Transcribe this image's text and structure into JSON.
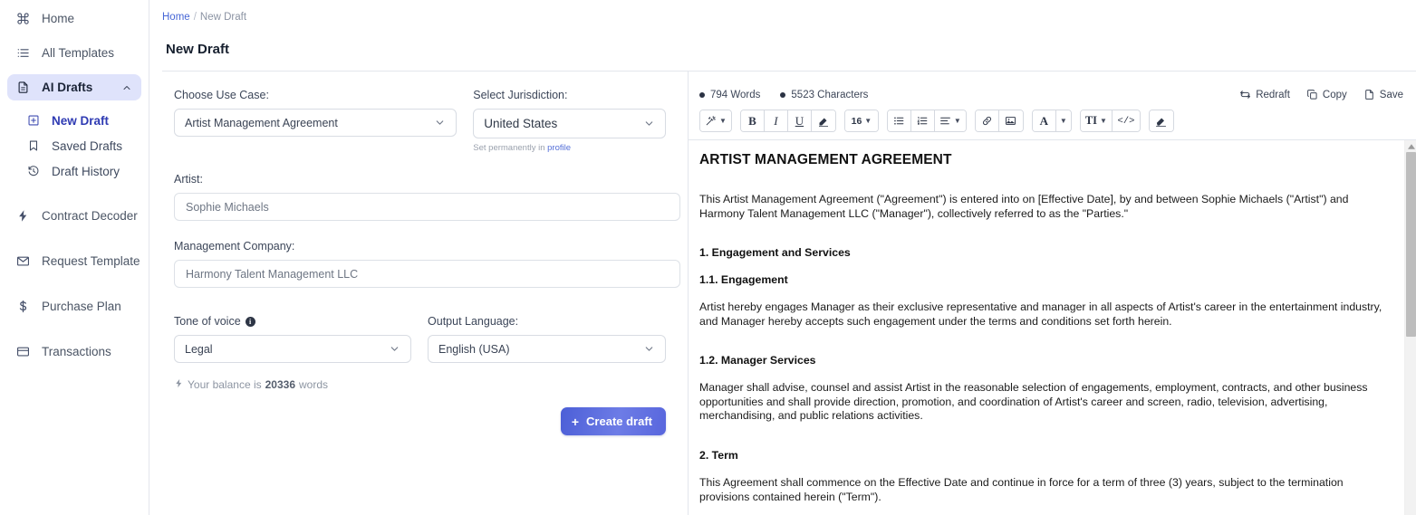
{
  "sidebar": {
    "items": [
      {
        "label": "Home",
        "icon": "command-icon"
      },
      {
        "label": "All Templates",
        "icon": "list-icon"
      },
      {
        "label": "AI Drafts",
        "icon": "document-icon",
        "active": true,
        "chevron": "chevron-up-icon"
      }
    ],
    "subitems": [
      {
        "label": "New Draft",
        "icon": "plus-square-icon"
      },
      {
        "label": "Saved Drafts",
        "icon": "bookmark-icon"
      },
      {
        "label": "Draft History",
        "icon": "history-icon"
      }
    ],
    "items2": [
      {
        "label": "Contract Decoder",
        "icon": "bolt-icon"
      },
      {
        "label": "Request Template",
        "icon": "envelope-icon"
      },
      {
        "label": "Purchase Plan",
        "icon": "dollar-icon"
      },
      {
        "label": "Transactions",
        "icon": "card-icon"
      }
    ],
    "active_bg": "#dfe3fb"
  },
  "breadcrumb": {
    "home": "Home",
    "separator": "/",
    "current": "New Draft"
  },
  "page_title": "New Draft",
  "form": {
    "use_case_label": "Choose Use Case:",
    "use_case_value": "Artist Management Agreement",
    "jurisdiction_label": "Select Jurisdiction:",
    "jurisdiction_value": "United States",
    "jurisdiction_hint_prefix": "Set permanently in ",
    "jurisdiction_hint_link": "profile",
    "artist_label": "Artist:",
    "artist_value": "Sophie Michaels",
    "company_label": "Management Company:",
    "company_value": "Harmony Talent Management LLC",
    "tone_label": "Tone of voice",
    "tone_value": "Legal",
    "language_label": "Output Language:",
    "language_value": "English (USA)",
    "balance_prefix": "Your balance is ",
    "balance_value": "20336",
    "balance_suffix": " words",
    "create_button": "Create draft",
    "create_button_plus": "+"
  },
  "editor": {
    "words": "794 Words",
    "characters": "5523 Characters",
    "actions": [
      {
        "label": "Redraft",
        "icon": "redraft-icon"
      },
      {
        "label": "Copy",
        "icon": "copy-icon"
      },
      {
        "label": "Save",
        "icon": "save-file-icon"
      }
    ],
    "toolbar": {
      "magic": "magic-wand-icon",
      "bold": "B",
      "italic": "I",
      "underline": "U",
      "eraser_small": "highlight-icon",
      "font_size": "16",
      "bullet_list": "bullet-list-icon",
      "numbered_list": "numbered-list-icon",
      "align": "align-icon",
      "link": "link-icon",
      "image": "image-icon",
      "font_color": "A",
      "text_style": "TI",
      "code": "</>",
      "clear_format": "eraser-icon"
    }
  },
  "document": {
    "title": "ARTIST MANAGEMENT AGREEMENT",
    "intro": "This Artist Management Agreement (\"Agreement\") is entered into on [Effective Date], by and between Sophie Michaels (\"Artist\") and Harmony Talent Management LLC (\"Manager\"), collectively referred to as the \"Parties.\"",
    "h_1": "1. Engagement and Services",
    "h_1_1": "1.1. Engagement",
    "p_1_1": "Artist hereby engages Manager as their exclusive representative and manager in all aspects of Artist's career in the entertainment industry, and Manager hereby accepts such engagement under the terms and conditions set forth herein.",
    "h_1_2": "1.2. Manager Services",
    "p_1_2": "Manager shall advise, counsel and assist Artist in the reasonable selection of engagements, employment, contracts, and other business opportunities and shall provide direction, promotion, and coordination of Artist's career and screen, radio, television, advertising, merchandising, and public relations activities.",
    "h_2": "2. Term",
    "p_2": "This Agreement shall commence on the Effective Date and continue in force for a term of three (3) years, subject to the termination provisions contained herein (\"Term\")."
  }
}
